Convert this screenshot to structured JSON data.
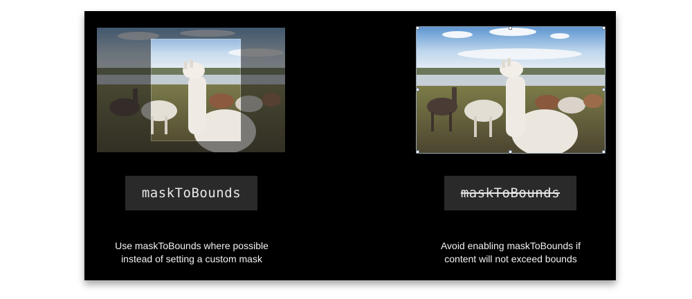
{
  "left_panel": {
    "code_label": "maskToBounds",
    "caption_line1": "Use maskToBounds where possible",
    "caption_line2": "instead of setting a custom mask"
  },
  "right_panel": {
    "code_label": "maskToBounds",
    "caption_line1": "Avoid enabling maskToBounds if",
    "caption_line2": "content will not exceed bounds"
  },
  "colors": {
    "slide_background": "#000000",
    "chip_background": "#2a2a2a",
    "chip_text": "#e9e9e9",
    "caption_text": "#f2f2f2",
    "bounds_outline": "#9aa7b6"
  }
}
